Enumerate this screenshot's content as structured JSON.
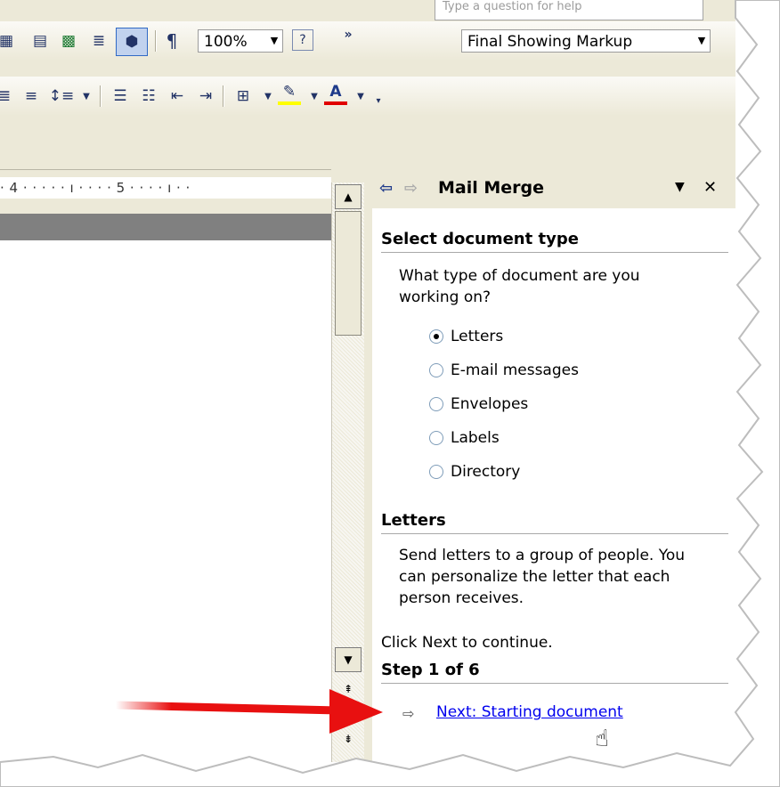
{
  "toolbar": {
    "search_placeholder": "Type a question for help",
    "zoom": "100%",
    "markup_view": "Final Showing Markup",
    "pilcrow": "¶",
    "help_glyph": "?",
    "more_glyph": "»"
  },
  "ruler": {
    "text": "· 4 · · · · · ı · · · · 5 · · · · ı · ·"
  },
  "task_pane": {
    "title": "Mail Merge",
    "section1_title": "Select document type",
    "question": "What type of document are you working on?",
    "options": [
      "Letters",
      "E-mail messages",
      "Envelopes",
      "Labels",
      "Directory"
    ],
    "selected": "Letters",
    "section2_title": "Letters",
    "description": "Send letters to a group of people. You can personalize the letter that each person receives.",
    "continue_text": "Click Next to continue.",
    "step_text": "Step 1 of 6",
    "next_link": "Next: Starting document"
  },
  "colors": {
    "highlight": "#FFFF00",
    "font_color": "#E00000",
    "annotation_arrow": "#E81010",
    "link": "#0000EE"
  }
}
